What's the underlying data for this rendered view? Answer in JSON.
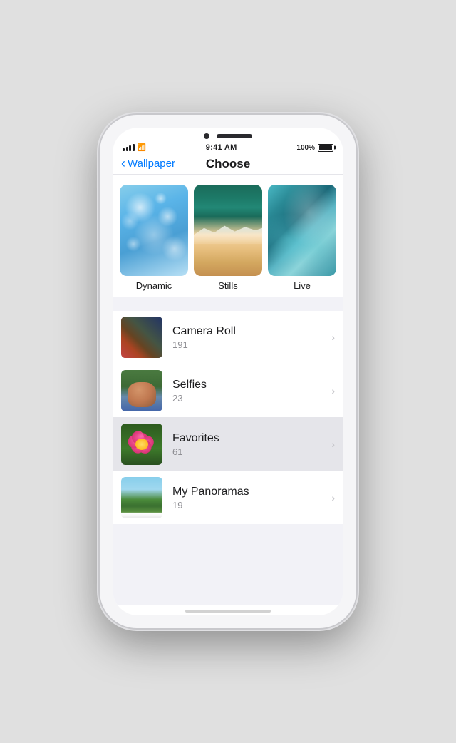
{
  "phone": {
    "status_bar": {
      "time": "9:41 AM",
      "battery_percent": "100%"
    },
    "nav": {
      "back_label": "Wallpaper",
      "title": "Choose"
    },
    "wallpaper_types": [
      {
        "id": "dynamic",
        "label": "Dynamic"
      },
      {
        "id": "stills",
        "label": "Stills"
      },
      {
        "id": "live",
        "label": "Live"
      }
    ],
    "albums": [
      {
        "id": "camera-roll",
        "label": "Camera Roll",
        "count": "191",
        "selected": false
      },
      {
        "id": "selfies",
        "label": "Selfies",
        "count": "23",
        "selected": false
      },
      {
        "id": "favorites",
        "label": "Favorites",
        "count": "61",
        "selected": true
      },
      {
        "id": "my-panoramas",
        "label": "My Panoramas",
        "count": "19",
        "selected": false
      }
    ]
  }
}
